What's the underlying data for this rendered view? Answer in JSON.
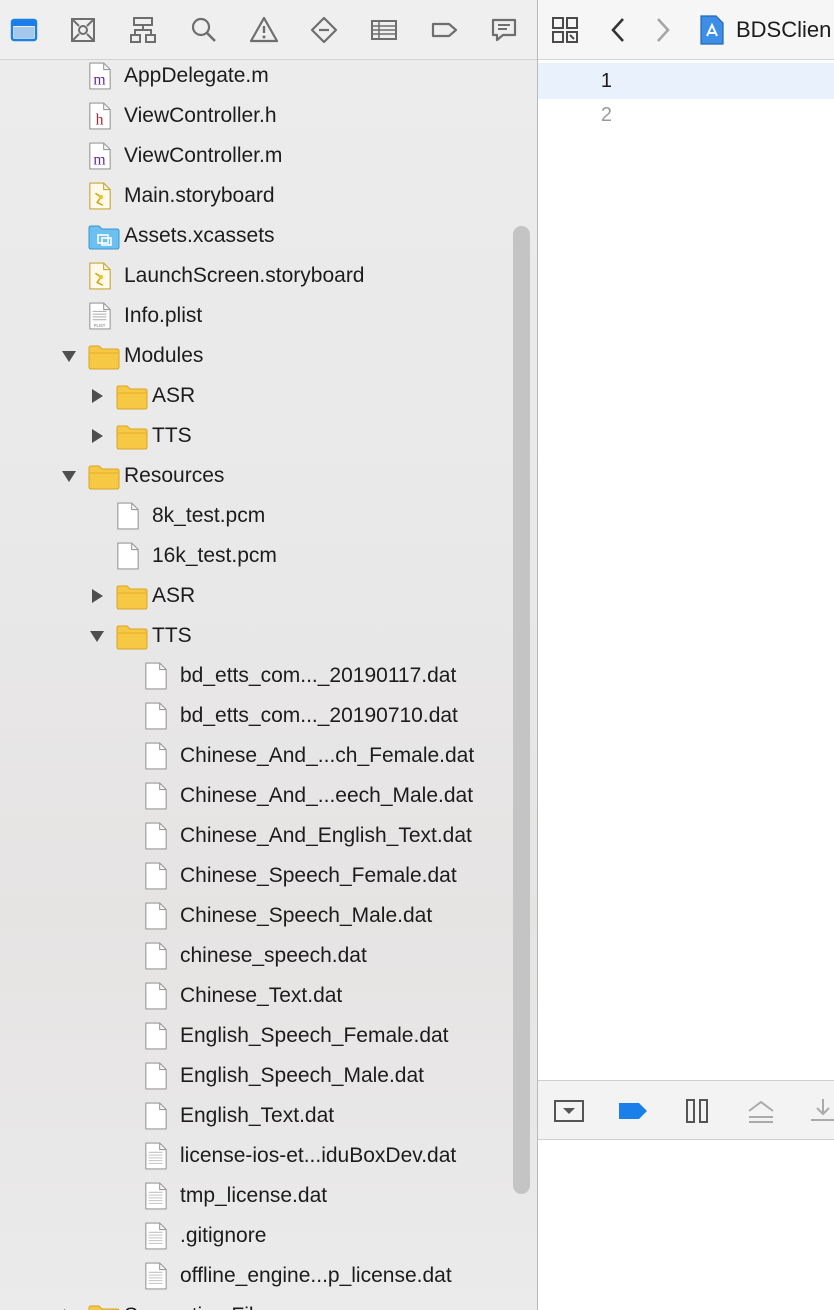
{
  "navigator": {
    "toolbar_icons": [
      "project-navigator-icon",
      "source-control-icon",
      "symbol-navigator-icon",
      "find-icon",
      "issue-icon",
      "test-icon",
      "debug-icon",
      "breakpoint-icon",
      "report-icon"
    ],
    "items": [
      {
        "name": "AppDelegate.m",
        "icon": "m-file",
        "depth": 1
      },
      {
        "name": "ViewController.h",
        "icon": "h-file",
        "depth": 1
      },
      {
        "name": "ViewController.m",
        "icon": "m-file",
        "depth": 1
      },
      {
        "name": "Main.storyboard",
        "icon": "storyboard",
        "depth": 1
      },
      {
        "name": "Assets.xcassets",
        "icon": "xcassets",
        "depth": 1
      },
      {
        "name": "LaunchScreen.storyboard",
        "icon": "storyboard",
        "depth": 1
      },
      {
        "name": "Info.plist",
        "icon": "plist",
        "depth": 1
      },
      {
        "name": "Modules",
        "icon": "folder",
        "depth": 1,
        "disclosure": "open"
      },
      {
        "name": "ASR",
        "icon": "folder",
        "depth": 2,
        "disclosure": "closed"
      },
      {
        "name": "TTS",
        "icon": "folder",
        "depth": 2,
        "disclosure": "closed"
      },
      {
        "name": "Resources",
        "icon": "folder",
        "depth": 1,
        "disclosure": "open"
      },
      {
        "name": "8k_test.pcm",
        "icon": "file",
        "depth": 2
      },
      {
        "name": "16k_test.pcm",
        "icon": "file",
        "depth": 2
      },
      {
        "name": "ASR",
        "icon": "folder",
        "depth": 2,
        "disclosure": "closed"
      },
      {
        "name": "TTS",
        "icon": "folder",
        "depth": 2,
        "disclosure": "open"
      },
      {
        "name": "bd_etts_com..._20190117.dat",
        "icon": "file",
        "depth": 3
      },
      {
        "name": "bd_etts_com..._20190710.dat",
        "icon": "file",
        "depth": 3
      },
      {
        "name": "Chinese_And_...ch_Female.dat",
        "icon": "file",
        "depth": 3
      },
      {
        "name": "Chinese_And_...eech_Male.dat",
        "icon": "file",
        "depth": 3
      },
      {
        "name": "Chinese_And_English_Text.dat",
        "icon": "file",
        "depth": 3
      },
      {
        "name": "Chinese_Speech_Female.dat",
        "icon": "file",
        "depth": 3
      },
      {
        "name": "Chinese_Speech_Male.dat",
        "icon": "file",
        "depth": 3
      },
      {
        "name": "chinese_speech.dat",
        "icon": "file",
        "depth": 3
      },
      {
        "name": "Chinese_Text.dat",
        "icon": "file",
        "depth": 3
      },
      {
        "name": "English_Speech_Female.dat",
        "icon": "file",
        "depth": 3
      },
      {
        "name": "English_Speech_Male.dat",
        "icon": "file",
        "depth": 3
      },
      {
        "name": "English_Text.dat",
        "icon": "file",
        "depth": 3
      },
      {
        "name": "license-ios-et...iduBoxDev.dat",
        "icon": "text-file",
        "depth": 3
      },
      {
        "name": "tmp_license.dat",
        "icon": "text-file",
        "depth": 3
      },
      {
        "name": ".gitignore",
        "icon": "text-file",
        "depth": 3
      },
      {
        "name": "offline_engine...p_license.dat",
        "icon": "text-file",
        "depth": 3
      },
      {
        "name": "Supporting Files",
        "icon": "folder",
        "depth": 1,
        "disclosure": "closed"
      }
    ]
  },
  "editor": {
    "breadcrumb": "BDSClien",
    "line_numbers": [
      "1",
      "2"
    ],
    "current_line": "1"
  },
  "colors": {
    "accent": "#1a7fe8",
    "folder": "#f7c844",
    "m_file_letter": "#6a2c8c",
    "h_file_letter": "#b0262f"
  }
}
